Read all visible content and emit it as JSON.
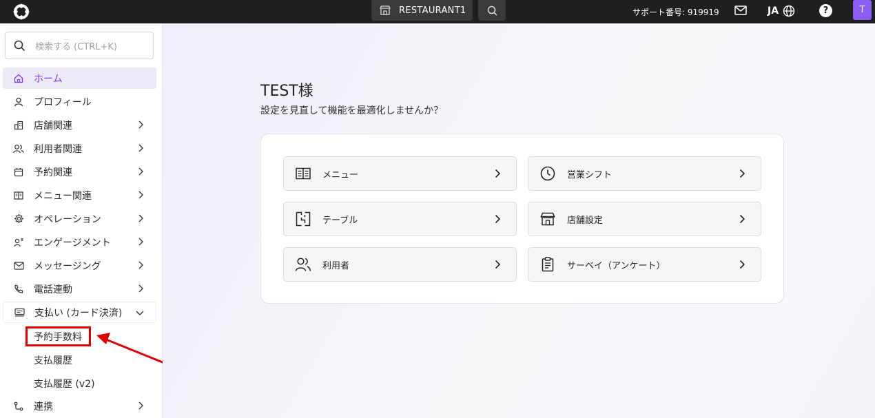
{
  "topbar": {
    "store_name": "RESTAURANT1",
    "support_label": "サポート番号: 919919",
    "language": "JA",
    "help_label": "?",
    "avatar_initial": "T"
  },
  "sidebar": {
    "search_placeholder": "検索する (CTRL+K)",
    "items": [
      {
        "label": "ホーム",
        "icon": "home-icon"
      },
      {
        "label": "プロフィール",
        "icon": "person-icon"
      },
      {
        "label": "店舗関連",
        "icon": "building-icon"
      },
      {
        "label": "利用者関連",
        "icon": "users-icon"
      },
      {
        "label": "予約関連",
        "icon": "calendar-icon"
      },
      {
        "label": "メニュー関連",
        "icon": "menu-book-icon"
      },
      {
        "label": "オペレーション",
        "icon": "gear-icon"
      },
      {
        "label": "エンゲージメント",
        "icon": "engagement-icon"
      },
      {
        "label": "メッセージング",
        "icon": "mail-icon"
      },
      {
        "label": "電話連動",
        "icon": "phone-icon"
      },
      {
        "label": "支払い (カード決済)",
        "icon": "payment-icon"
      },
      {
        "label": "連携",
        "icon": "integration-icon"
      }
    ],
    "sub_items": [
      {
        "label": "予約手数料"
      },
      {
        "label": "支払履歴"
      },
      {
        "label": "支払履歴 (v2)"
      }
    ]
  },
  "main": {
    "greeting": "TEST様",
    "subtitle": "設定を見直して機能を最適化しませんか？",
    "tiles": [
      {
        "label": "メニュー",
        "icon": "menu-book-icon"
      },
      {
        "label": "営業シフト",
        "icon": "clock-icon"
      },
      {
        "label": "テーブル",
        "icon": "table-icon"
      },
      {
        "label": "店舗設定",
        "icon": "store-icon"
      },
      {
        "label": "利用者",
        "icon": "users-icon"
      },
      {
        "label": "サーベイ（アンケート）",
        "icon": "clipboard-icon"
      }
    ]
  },
  "colors": {
    "accent": "#7c3aed",
    "avatar": "#8b5cf6",
    "annotation": "#e00000",
    "topbar": "#1f1f1f"
  }
}
